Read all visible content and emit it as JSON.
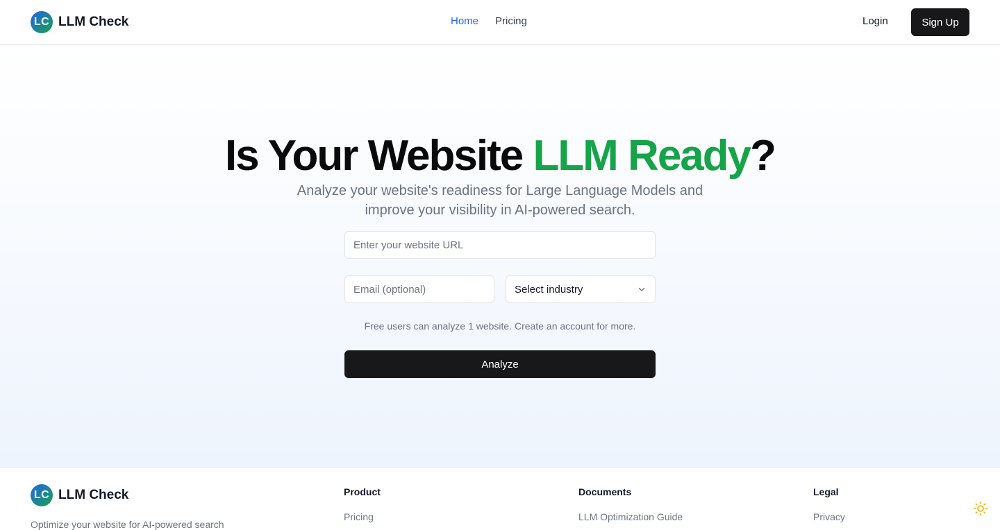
{
  "header": {
    "logo_initials": "LC",
    "brand": "LLM Check",
    "nav": [
      {
        "label": "Home",
        "active": true
      },
      {
        "label": "Pricing",
        "active": false
      }
    ],
    "login_label": "Login",
    "signup_label": "Sign Up"
  },
  "hero": {
    "title_prefix": "Is Your Website ",
    "title_accent": "LLM Ready",
    "title_suffix": "?",
    "subtitle": "Analyze your website's readiness for Large Language Models and improve your visibility in AI-powered search.",
    "url_placeholder": "Enter your website URL",
    "email_placeholder": "Email (optional)",
    "industry_select": "Select industry",
    "note": "Free users can analyze 1 website. Create an account for more.",
    "analyze_label": "Analyze"
  },
  "footer": {
    "logo_initials": "LC",
    "brand": "LLM Check",
    "tagline": "Optimize your website for AI-powered search",
    "columns": [
      {
        "heading": "Product",
        "links": [
          "Pricing"
        ]
      },
      {
        "heading": "Documents",
        "links": [
          "LLM Optimization Guide"
        ]
      },
      {
        "heading": "Legal",
        "links": [
          "Privacy"
        ]
      }
    ]
  },
  "colors": {
    "accent_green": "#16a34a",
    "link_blue": "#2563eb",
    "button_dark": "#18181b",
    "sun_icon": "#eab308"
  },
  "icons": {
    "select": "chevron-down-icon",
    "theme": "sun-icon"
  }
}
